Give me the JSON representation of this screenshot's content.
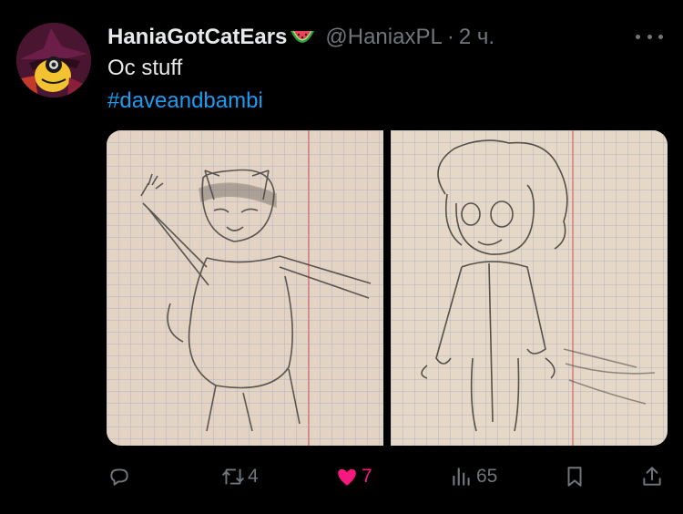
{
  "tweet": {
    "display_name": "HaniaGotCatEars",
    "name_emoji_icon": "watermelon-icon",
    "handle": "@HaniaxPL",
    "separator": "·",
    "time": "2 ч.",
    "text": "Oc stuff",
    "hashtag": "#daveandbambi"
  },
  "media": [
    {
      "description_icon": "sketch-photo-cat-oc"
    },
    {
      "description_icon": "sketch-photo-curly-oc"
    }
  ],
  "actions": {
    "reply": {
      "icon": "reply-icon"
    },
    "retweet": {
      "icon": "retweet-icon",
      "count": "4"
    },
    "like": {
      "icon": "heart-icon",
      "count": "7",
      "color": "#f91880"
    },
    "views": {
      "icon": "views-icon",
      "count": "65"
    },
    "bookmark": {
      "icon": "bookmark-icon"
    },
    "share": {
      "icon": "share-icon"
    }
  },
  "colors": {
    "background": "#000000",
    "text": "#e7e9ea",
    "muted": "#71767b",
    "link": "#1d9bf0",
    "like": "#f91880"
  }
}
